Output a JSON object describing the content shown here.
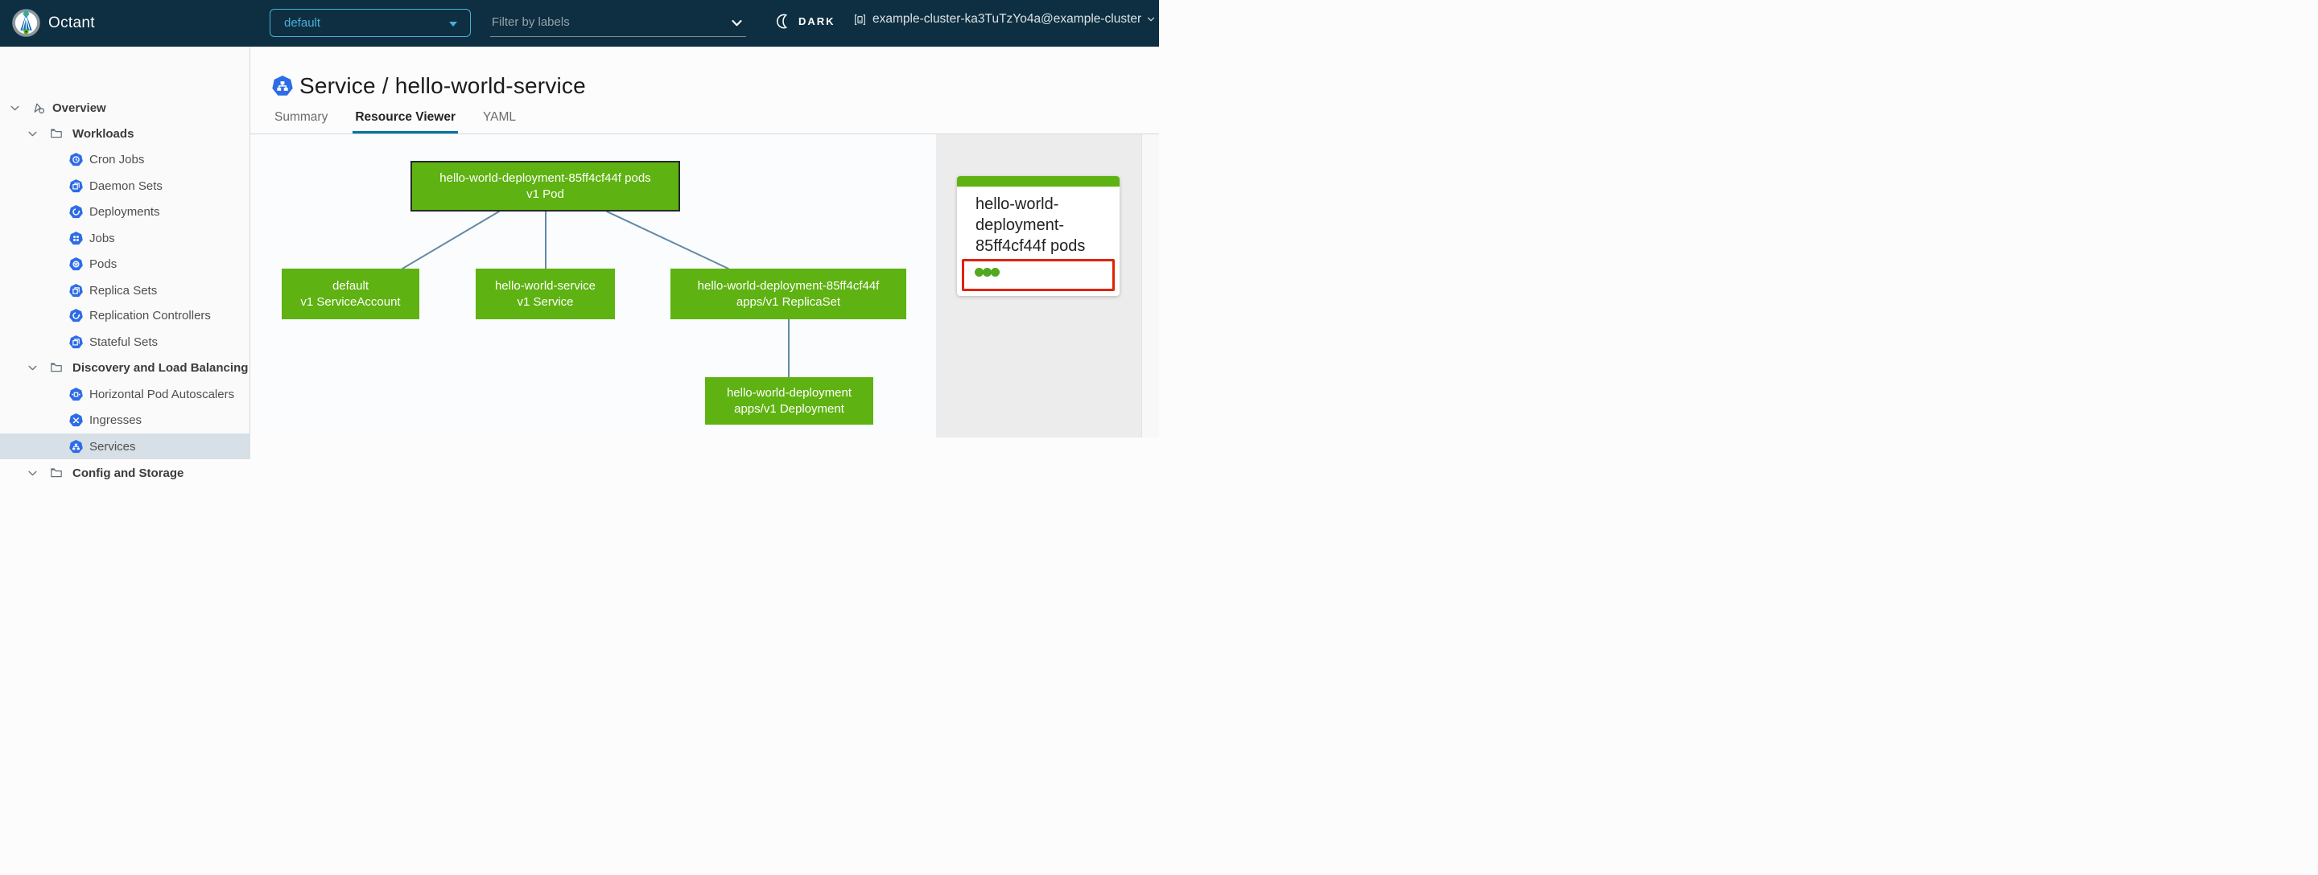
{
  "header": {
    "app_title": "Octant",
    "namespace": {
      "value": "default"
    },
    "filter": {
      "placeholder": "Filter by labels"
    },
    "theme_toggle": {
      "label": "DARK"
    },
    "context": {
      "label": "example-cluster-ka3TuTzYo4a@example-cluster"
    }
  },
  "sidebar": {
    "items": [
      {
        "label": "Overview",
        "depth": 1,
        "expanded": true
      },
      {
        "label": "Workloads",
        "depth": 2,
        "expanded": true
      },
      {
        "label": "Cron Jobs",
        "depth": 3
      },
      {
        "label": "Daemon Sets",
        "depth": 3
      },
      {
        "label": "Deployments",
        "depth": 3
      },
      {
        "label": "Jobs",
        "depth": 3
      },
      {
        "label": "Pods",
        "depth": 3
      },
      {
        "label": "Replica Sets",
        "depth": 3
      },
      {
        "label": "Replication Controllers",
        "depth": 3
      },
      {
        "label": "Stateful Sets",
        "depth": 3
      },
      {
        "label": "Discovery and Load Balancing",
        "depth": 2,
        "expanded": true
      },
      {
        "label": "Horizontal Pod Autoscalers",
        "depth": 3
      },
      {
        "label": "Ingresses",
        "depth": 3
      },
      {
        "label": "Services",
        "depth": 3,
        "selected": true
      },
      {
        "label": "Config and Storage",
        "depth": 2,
        "expanded": true
      }
    ]
  },
  "main": {
    "resource_title": "Service / hello-world-service",
    "tabs": [
      {
        "label": "Summary",
        "active": false
      },
      {
        "label": "Resource Viewer",
        "active": true
      },
      {
        "label": "YAML",
        "active": false
      }
    ]
  },
  "graph": {
    "nodes": [
      {
        "id": "pod",
        "line1": "hello-world-deployment-85ff4cf44f pods",
        "line2": "v1 Pod",
        "selected": true
      },
      {
        "id": "serviceaccount",
        "line1": "default",
        "line2": "v1 ServiceAccount",
        "selected": false
      },
      {
        "id": "service",
        "line1": "hello-world-service",
        "line2": "v1 Service",
        "selected": false
      },
      {
        "id": "replicaset",
        "line1": "hello-world-deployment-85ff4cf44f",
        "line2": "apps/v1 ReplicaSet",
        "selected": false
      },
      {
        "id": "deployment",
        "line1": "hello-world-deployment",
        "line2": "apps/v1 Deployment",
        "selected": false
      }
    ],
    "edges": [
      [
        "pod",
        "serviceaccount"
      ],
      [
        "pod",
        "service"
      ],
      [
        "pod",
        "replicaset"
      ],
      [
        "replicaset",
        "deployment"
      ]
    ]
  },
  "detail_panel": {
    "title": "hello-world-deployment-85ff4cf44f pods",
    "pod_status": {
      "ok_count": 3
    }
  },
  "colors": {
    "header_bg": "#0e2f41",
    "accent_blue": "#49afd9",
    "tab_active_underline": "#0072a3",
    "resource_icon_blue": "#2e6ce6",
    "node_green": "#5eb211",
    "edge_blue": "#6288a5",
    "panel_gray": "#ececec",
    "alert_red": "#e12200",
    "status_dot_green": "#52a81e",
    "selected_row_bg": "#d6e0e6"
  }
}
